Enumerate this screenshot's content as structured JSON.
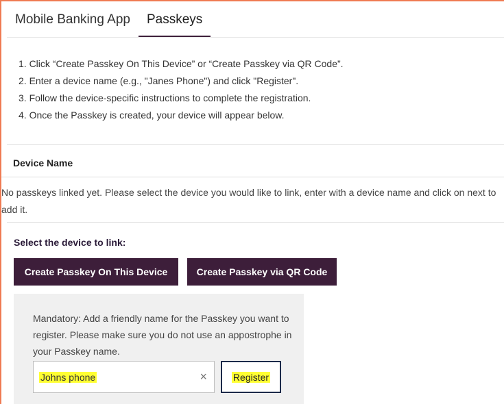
{
  "tabs": [
    {
      "label": "Mobile Banking App"
    },
    {
      "label": "Passkeys"
    }
  ],
  "instructions": [
    "1. Click “Create Passkey On This Device” or “Create Passkey via QR Code”.",
    "2. Enter a device name (e.g., \"Janes Phone\") and click \"Register\".",
    "3. Follow the device-specific instructions to complete the registration.",
    "4. Once the Passkey is created, your device will appear below."
  ],
  "device_table": {
    "header": "Device Name",
    "empty_message": "No passkeys linked yet. Please select the device you would like to link, enter with a device name and click on next to add it."
  },
  "select_device": {
    "label": "Select the device to link:",
    "create_on_device_label": "Create Passkey On This Device",
    "create_via_qr_label": "Create Passkey via QR Code"
  },
  "register_panel": {
    "instructions": "Mandatory: Add a friendly name for the Passkey you want to register. Please make sure you do not use an appostrophe in your Passkey name.",
    "name_value": "Johns phone",
    "clear_glyph": "×",
    "register_label": "Register"
  },
  "colors": {
    "accent": "#ef7b52",
    "button_dark": "#3d1e3a",
    "highlight": "#ffff33",
    "panel_bg": "#f0f0f0"
  }
}
